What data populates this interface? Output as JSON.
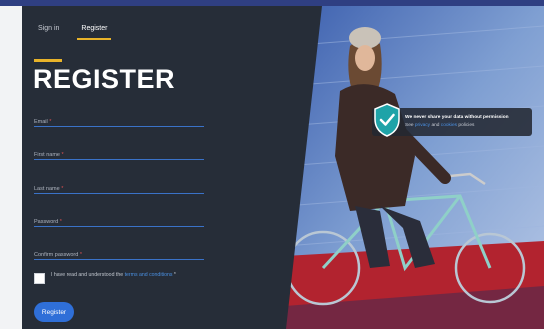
{
  "tabs": {
    "signin": "Sign in",
    "register": "Register"
  },
  "heading": "REGISTER",
  "fields": [
    {
      "label": "Email",
      "required": "*"
    },
    {
      "label": "First name",
      "required": "*"
    },
    {
      "label": "Last name",
      "required": "*"
    },
    {
      "label": "Password",
      "required": "*"
    },
    {
      "label": "Confirm password",
      "required": "*"
    }
  ],
  "consent": {
    "prefix": "I have read and understood the",
    "link": "terms and conditions",
    "suffix": "*"
  },
  "register_button": "Register",
  "privacy_notice": {
    "message": "We never share your data without permission",
    "see": "See",
    "privacy_link": "privacy",
    "and": "and",
    "cookies_link": "cookies",
    "policies": "policies"
  },
  "colors": {
    "panel": "#262d38",
    "accent": "#e8b32a",
    "field_underline": "#3a72c8",
    "button": "#2f6fd8",
    "shield": "#1fa3a8"
  },
  "icons": {
    "notice": "shield-check-icon"
  }
}
